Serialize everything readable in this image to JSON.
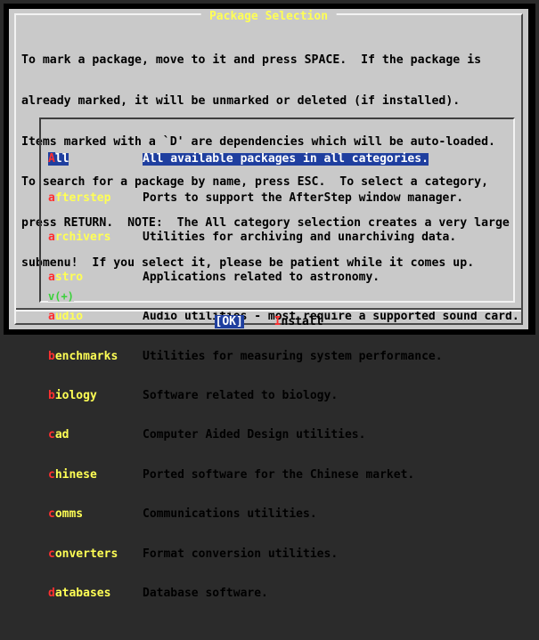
{
  "dialog": {
    "title": " Package Selection ",
    "prompt_lines": [
      "To mark a package, move to it and press SPACE.  If the package is",
      "already marked, it will be unmarked or deleted (if installed).",
      "Items marked with a `D' are dependencies which will be auto-loaded.",
      "To search for a package by name, press ESC.  To select a category,",
      "press RETURN.  NOTE:  The All category selection creates a very large",
      "submenu!  If you select it, please be patient while it comes up."
    ]
  },
  "list": {
    "items": [
      {
        "hot": "A",
        "rest": "ll",
        "desc": "All available packages in all categories.",
        "selected": true
      },
      {
        "hot": "a",
        "rest": "fterstep",
        "desc": "Ports to support the AfterStep window manager.",
        "selected": false
      },
      {
        "hot": "a",
        "rest": "rchivers",
        "desc": "Utilities for archiving and unarchiving data.",
        "selected": false
      },
      {
        "hot": "a",
        "rest": "stro",
        "desc": "Applications related to astronomy.",
        "selected": false
      },
      {
        "hot": "a",
        "rest": "udio",
        "desc": "Audio utilities - most require a supported sound card.",
        "selected": false
      },
      {
        "hot": "b",
        "rest": "enchmarks",
        "desc": "Utilities for measuring system performance.",
        "selected": false
      },
      {
        "hot": "b",
        "rest": "iology",
        "desc": "Software related to biology.",
        "selected": false
      },
      {
        "hot": "c",
        "rest": "ad",
        "desc": "Computer Aided Design utilities.",
        "selected": false
      },
      {
        "hot": "c",
        "rest": "hinese",
        "desc": "Ported software for the Chinese market.",
        "selected": false
      },
      {
        "hot": "c",
        "rest": "omms",
        "desc": "Communications utilities.",
        "selected": false
      },
      {
        "hot": "c",
        "rest": "onverters",
        "desc": "Format conversion utilities.",
        "selected": false
      },
      {
        "hot": "d",
        "rest": "atabases",
        "desc": "Database software.",
        "selected": false
      }
    ],
    "more_indicator": "v(+)"
  },
  "buttons": {
    "ok_label": "[OK]",
    "install_hot": "I",
    "install_rest": "nstall"
  },
  "colors": {
    "background": "#c9c9c9",
    "title": "#ffff55",
    "selection": "#1f3f9f",
    "hotkey": "#ff3030",
    "tag": "#ffff55",
    "more": "#39d139"
  }
}
